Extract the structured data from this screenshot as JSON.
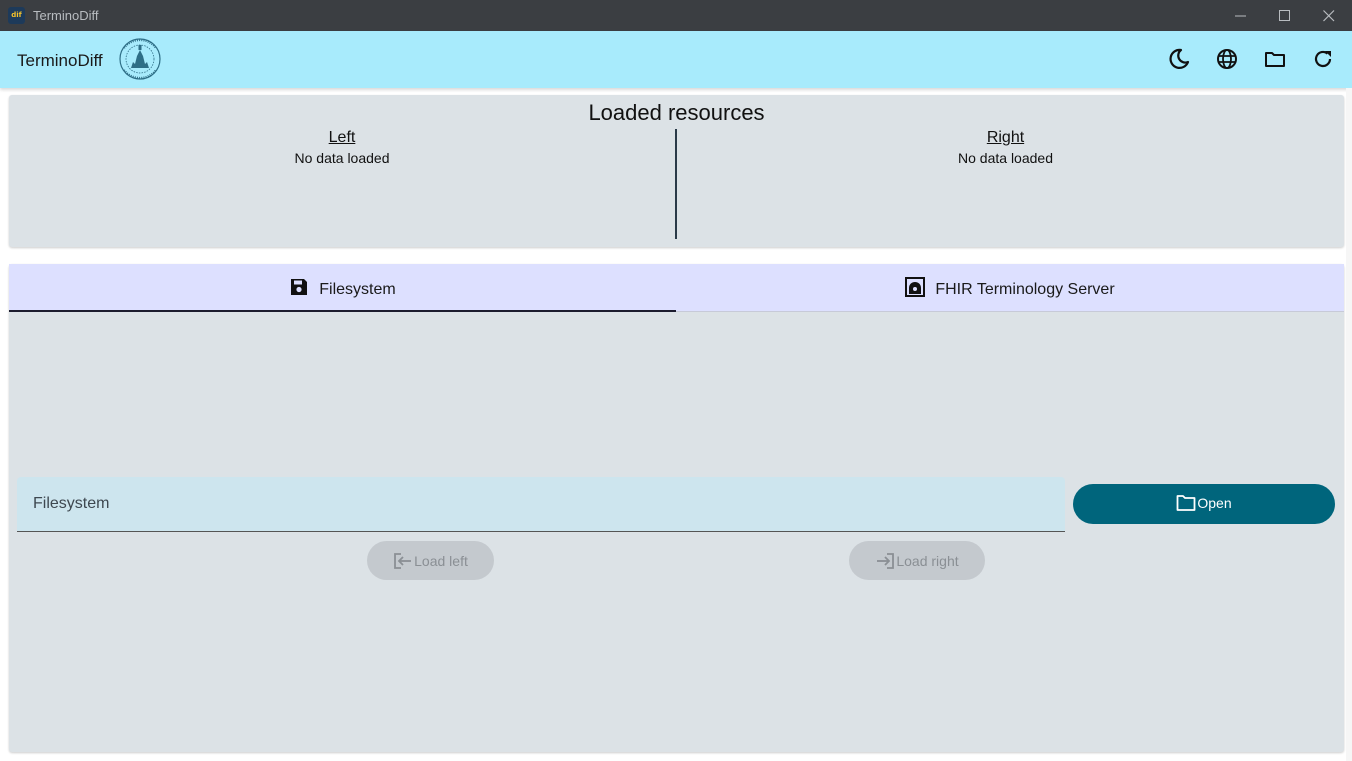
{
  "window": {
    "title": "TerminoDiff",
    "app_icon_text": "dif"
  },
  "header": {
    "app_title": "TerminoDiff",
    "actions": [
      "dark-mode",
      "language",
      "open-folder",
      "reload"
    ]
  },
  "loaded_resources": {
    "heading": "Loaded resources",
    "left": {
      "label": "Left",
      "status": "No data loaded"
    },
    "right": {
      "label": "Right",
      "status": "No data loaded"
    }
  },
  "tabs": [
    {
      "label": "Filesystem",
      "icon": "save-icon",
      "active": true
    },
    {
      "label": "FHIR Terminology Server",
      "icon": "server-icon",
      "active": false
    }
  ],
  "filesystem": {
    "placeholder": "Filesystem",
    "open_label": "Open",
    "load_left_label": "Load left",
    "load_right_label": "Load right"
  },
  "colors": {
    "titlebar": "#3b3e42",
    "appbar": "#a8ebfc",
    "card": "#dce2e6",
    "tabbar": "#dde0ff",
    "primary_button": "#00657c",
    "disabled_button": "#c4c9ce"
  }
}
